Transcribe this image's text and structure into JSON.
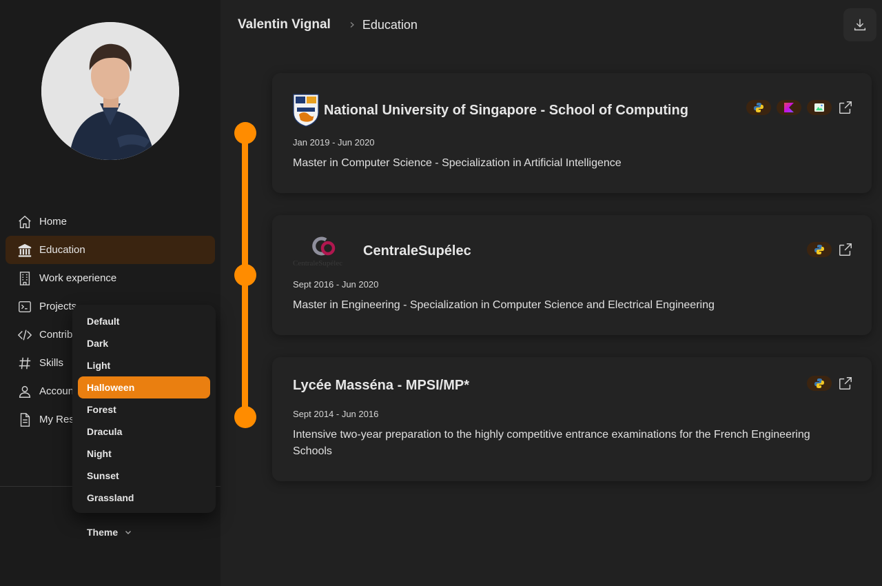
{
  "colors": {
    "accent": "#ff8c00",
    "active_theme_bg": "#ea7f10",
    "active_nav_bg": "#3a2410"
  },
  "sidebar": {
    "nav": [
      {
        "label": "Home",
        "icon": "home-icon"
      },
      {
        "label": "Education",
        "icon": "university-icon",
        "active": true
      },
      {
        "label": "Work experience",
        "icon": "building-icon"
      },
      {
        "label": "Projects",
        "icon": "terminal-icon"
      },
      {
        "label": "Contrib",
        "icon": "code-icon"
      },
      {
        "label": "Skills",
        "icon": "hashtag-icon"
      },
      {
        "label": "Accoun",
        "icon": "user-icon"
      },
      {
        "label": "My Res",
        "icon": "document-icon"
      }
    ],
    "theme_label": "Theme",
    "theme_options": [
      "Default",
      "Dark",
      "Light",
      "Halloween",
      "Forest",
      "Dracula",
      "Night",
      "Sunset",
      "Grassland"
    ],
    "theme_selected": "Halloween"
  },
  "header": {
    "name": "Valentin Vignal",
    "page": "Education"
  },
  "education": [
    {
      "school": "National University of Singapore - School of Computing",
      "logo": "nus-logo",
      "dates": "Jan 2019 - Jun 2020",
      "description": "Master in Computer Science - Specialization in Artificial Intelligence",
      "tags": [
        "python-icon",
        "kotlin-icon",
        "android-studio-icon"
      ]
    },
    {
      "school": "CentraleSupélec",
      "logo": "centralesupelec-logo",
      "logo_text": "CentraleSupélec",
      "dates": "Sept 2016 - Jun 2020",
      "description": "Master in Engineering - Specialization in Computer Science and Electrical Engineering",
      "tags": [
        "python-icon"
      ]
    },
    {
      "school": "Lycée Masséna - MPSI/MP*",
      "dates": "Sept 2014 - Jun 2016",
      "description": "Intensive two-year preparation to the highly competitive entrance examinations for the French Engineering Schools",
      "tags": [
        "python-icon"
      ]
    }
  ]
}
